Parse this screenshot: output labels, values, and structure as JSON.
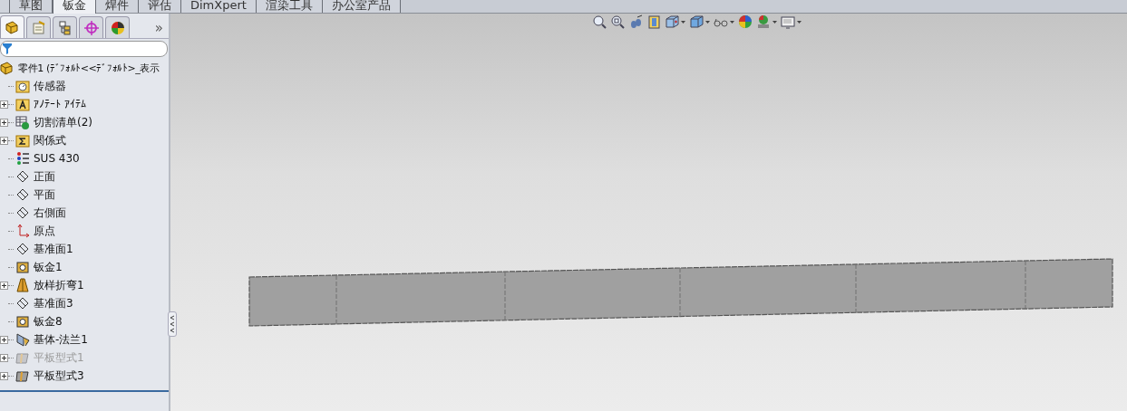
{
  "command_tabs": [
    {
      "partial": true,
      "selected": false
    },
    {
      "label": "草图",
      "selected": false
    },
    {
      "label": "钣金",
      "selected": true
    },
    {
      "label": "焊件",
      "selected": false
    },
    {
      "label": "评估",
      "selected": false
    },
    {
      "label": "DimXpert",
      "selected": false
    },
    {
      "label": "渲染工具",
      "selected": false
    },
    {
      "label": "办公室产品",
      "selected": false
    }
  ],
  "panel_tabs": [
    {
      "kind": "feature",
      "selected": true
    },
    {
      "kind": "property",
      "selected": false
    },
    {
      "kind": "config",
      "selected": false
    },
    {
      "kind": "dimxpert",
      "selected": false
    },
    {
      "kind": "display",
      "selected": false
    }
  ],
  "panel_more": "»",
  "tree": {
    "label": "零件1 (ﾃﾞﾌｫﾙﾄ<<ﾃﾞﾌｫﾙﾄ>_表示",
    "children": [
      {
        "label": "传感器",
        "kind": "sensor",
        "expandable": false,
        "disabled": false
      },
      {
        "label": "ｱﾉﾃｰﾄ ｱｲﾃﾑ",
        "kind": "annotation",
        "expandable": true,
        "disabled": false
      },
      {
        "label": "切割清单(2)",
        "kind": "cutlist",
        "expandable": true,
        "disabled": false
      },
      {
        "label": "関係式",
        "kind": "equation",
        "expandable": true,
        "disabled": false
      },
      {
        "label": "SUS 430",
        "kind": "material",
        "expandable": false,
        "disabled": false
      },
      {
        "label": "正面",
        "kind": "plane",
        "expandable": false,
        "disabled": false
      },
      {
        "label": "平面",
        "kind": "plane",
        "expandable": false,
        "disabled": false
      },
      {
        "label": "右側面",
        "kind": "plane",
        "expandable": false,
        "disabled": false
      },
      {
        "label": "原点",
        "kind": "origin",
        "expandable": false,
        "disabled": false
      },
      {
        "label": "基准面1",
        "kind": "plane",
        "expandable": false,
        "disabled": false
      },
      {
        "label": "钣金1",
        "kind": "sheetmetal",
        "expandable": false,
        "disabled": false
      },
      {
        "label": "放样折弯1",
        "kind": "loft",
        "expandable": true,
        "disabled": false
      },
      {
        "label": "基准面3",
        "kind": "plane",
        "expandable": false,
        "disabled": false
      },
      {
        "label": "钣金8",
        "kind": "sheetmetal",
        "expandable": false,
        "disabled": false
      },
      {
        "label": "基体-法兰1",
        "kind": "flange",
        "expandable": true,
        "disabled": false
      },
      {
        "label": "平板型式1",
        "kind": "flat",
        "expandable": true,
        "disabled": true
      },
      {
        "label": "平板型式3",
        "kind": "flat",
        "expandable": true,
        "disabled": false
      }
    ]
  },
  "view_toolbar": [
    {
      "kind": "zoom-fit",
      "dropdown": false
    },
    {
      "kind": "zoom-area",
      "dropdown": false
    },
    {
      "kind": "previous-view",
      "dropdown": false
    },
    {
      "kind": "section",
      "dropdown": false
    },
    {
      "kind": "orientation",
      "dropdown": true
    },
    {
      "kind": "display-style",
      "dropdown": true
    },
    {
      "kind": "hide-show",
      "dropdown": true
    },
    {
      "kind": "appearance",
      "dropdown": false
    },
    {
      "kind": "scene",
      "dropdown": true
    },
    {
      "kind": "view-settings",
      "dropdown": true
    }
  ]
}
